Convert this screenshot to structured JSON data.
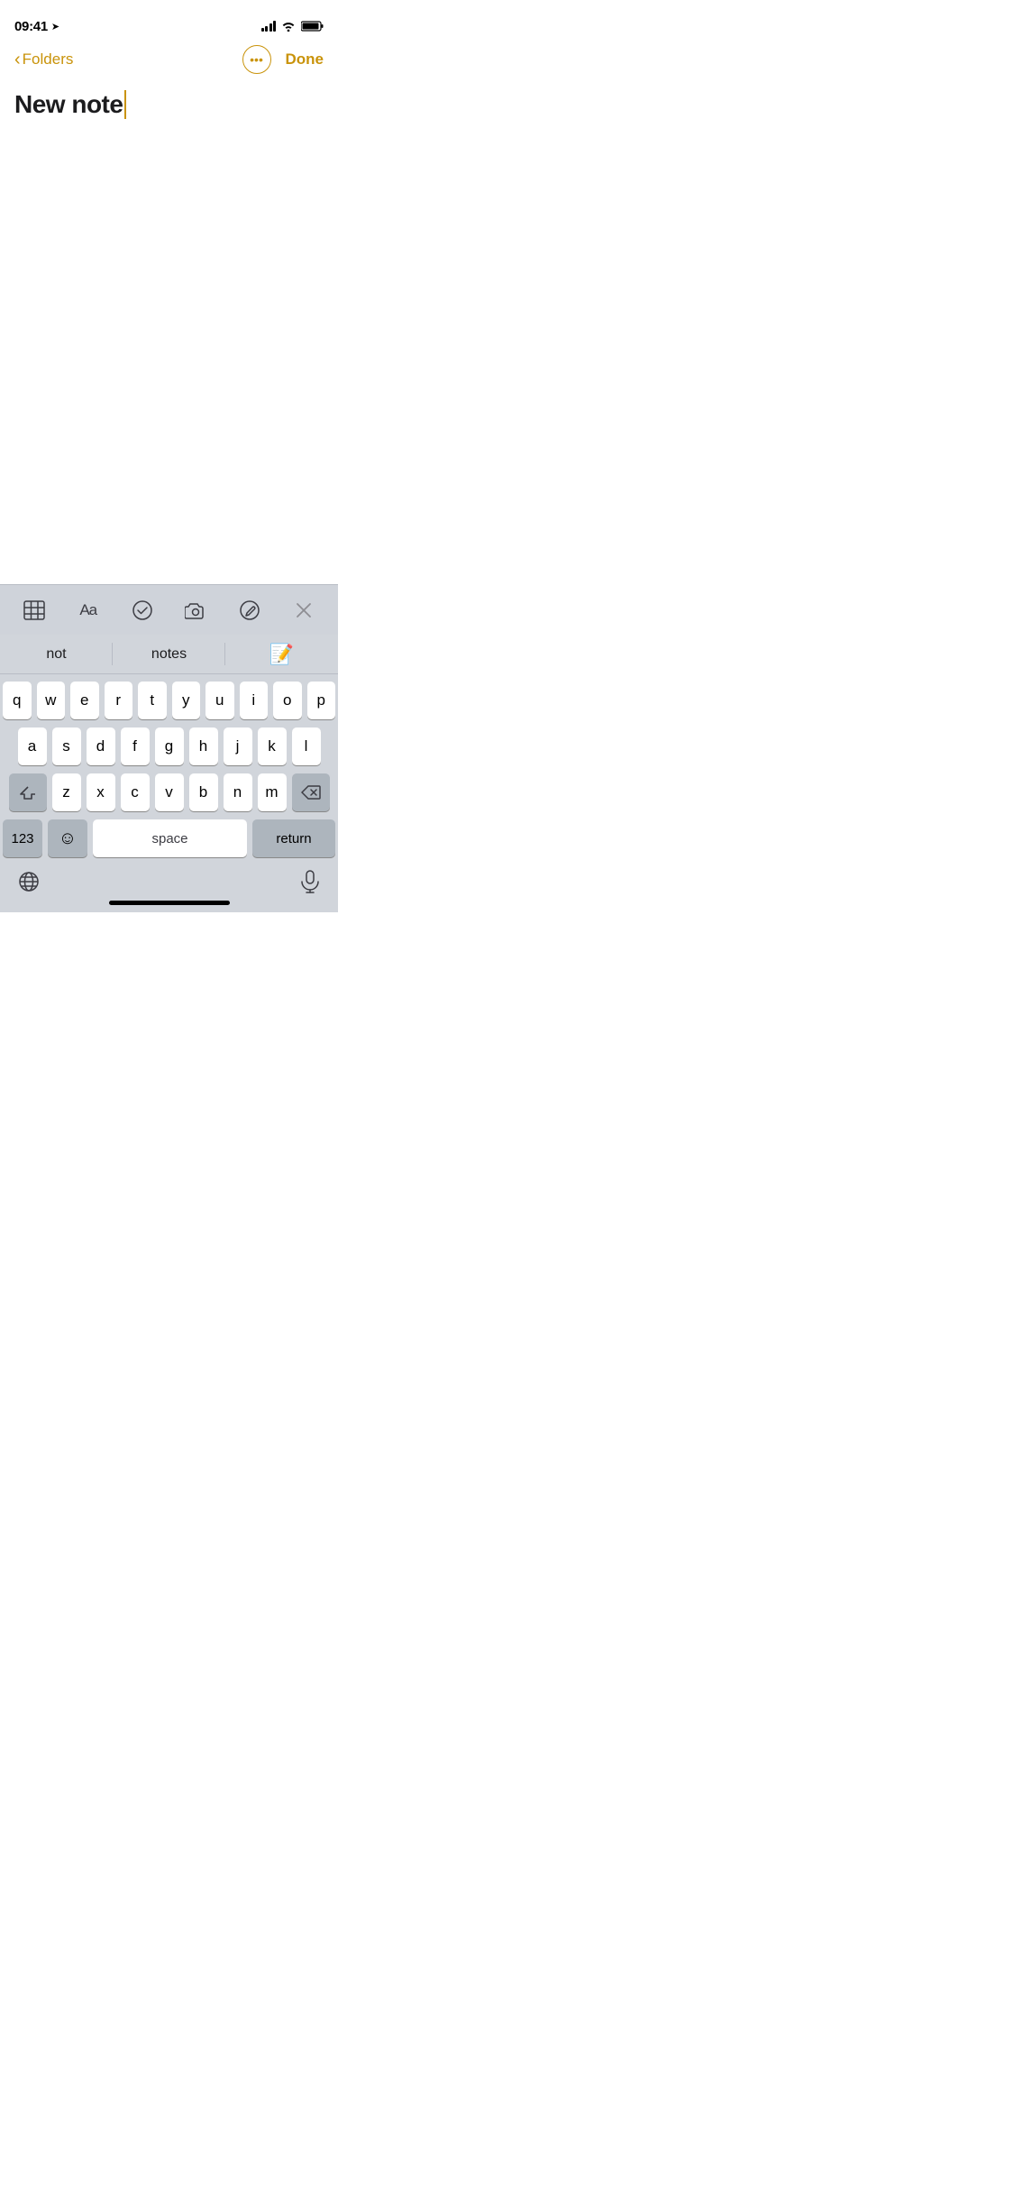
{
  "statusBar": {
    "time": "09:41",
    "hasLocation": true
  },
  "navBar": {
    "backLabel": "Folders",
    "doneLabel": "Done"
  },
  "note": {
    "title": "New note"
  },
  "toolbar": {
    "buttons": [
      "table",
      "format",
      "checklist",
      "camera",
      "markup",
      "close"
    ]
  },
  "predictive": {
    "items": [
      "not",
      "notes",
      "📝"
    ]
  },
  "keyboard": {
    "row1": [
      "q",
      "w",
      "e",
      "r",
      "t",
      "y",
      "u",
      "i",
      "o",
      "p"
    ],
    "row2": [
      "a",
      "s",
      "d",
      "f",
      "g",
      "h",
      "j",
      "k",
      "l"
    ],
    "row3": [
      "z",
      "x",
      "c",
      "v",
      "b",
      "n",
      "m"
    ],
    "spaceLabel": "space",
    "returnLabel": "return",
    "numbersLabel": "123"
  }
}
